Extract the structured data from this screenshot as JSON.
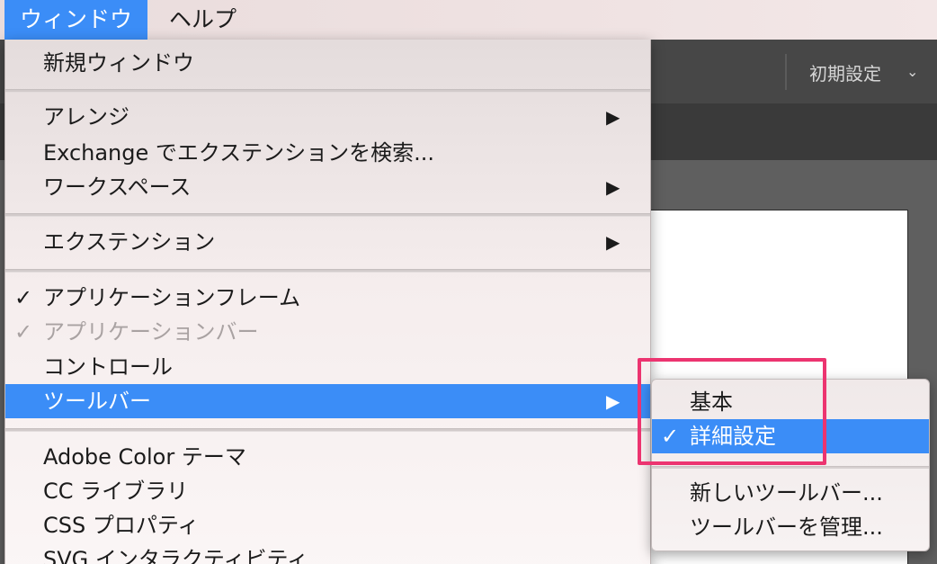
{
  "menubar": {
    "window_label": "ウィンドウ",
    "help_label": "ヘルプ"
  },
  "app": {
    "workspace_label": "初期設定",
    "workspace_chevron": "⌄"
  },
  "window_menu": {
    "items": {
      "new_window": "新規ウィンドウ",
      "arrange": "アレンジ",
      "exchange": "Exchange でエクステンションを検索...",
      "workspace": "ワークスペース",
      "extensions": "エクステンション",
      "app_frame": "アプリケーションフレーム",
      "app_bar": "アプリケーションバー",
      "control": "コントロール",
      "toolbar": "ツールバー",
      "adobe_color": "Adobe Color テーマ",
      "cc_libraries": "CC ライブラリ",
      "css_properties": "CSS プロパティ",
      "svg_interactivity": "SVG インタラクティビティ"
    },
    "checkmark": "✓",
    "submenu_arrow": "▶"
  },
  "toolbar_submenu": {
    "basic": "基本",
    "advanced": "詳細設定",
    "new_toolbar": "新しいツールバー...",
    "manage_toolbars": "ツールバーを管理..."
  },
  "colors": {
    "highlight": "#3b8df7",
    "annotation": "#ec3470"
  }
}
